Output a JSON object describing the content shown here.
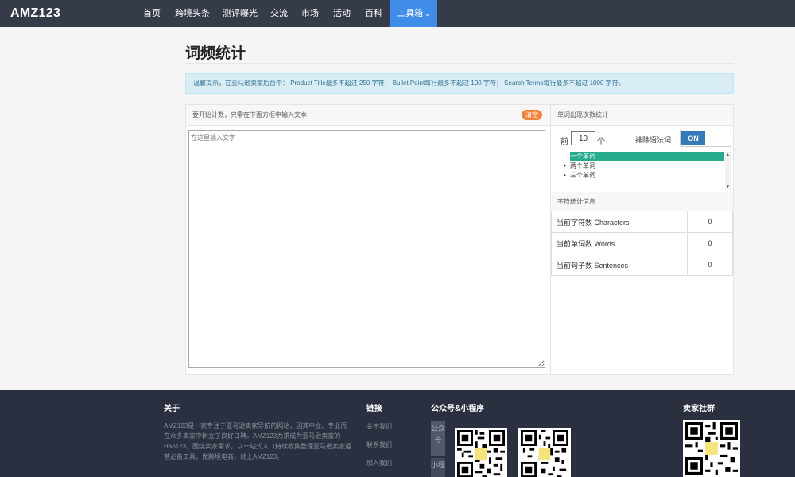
{
  "nav": {
    "logo": "AMZ123",
    "items": [
      {
        "label": "首页"
      },
      {
        "label": "跨境头条"
      },
      {
        "label": "测评曝光"
      },
      {
        "label": "交流"
      },
      {
        "label": "市场"
      },
      {
        "label": "活动"
      },
      {
        "label": "百科"
      },
      {
        "label": "工具箱",
        "active": true
      }
    ],
    "chevron": "chevron-down-icon"
  },
  "page": {
    "title": "词频统计",
    "tip": "温馨提示，在亚马逊卖家后台中：  Product Title最多不超过 250 字符；   Bullet Point每行最多不超过 100 字符；   Search Terms每行最多不超过 1000 字符。"
  },
  "input_panel": {
    "header": "要开始计数，只需在下面方框中输入文本",
    "clear_label": "清空",
    "textarea_placeholder": "在这里输入文字",
    "textarea_value": ""
  },
  "word_count_panel": {
    "header": "单词出现次数统计",
    "prefix": "前",
    "top_n": "10",
    "suffix": "个",
    "exclude_label": "排除语法词",
    "toggle_label": "ON",
    "toggle_state": true,
    "options": [
      {
        "label": "一个单词",
        "selected": true
      },
      {
        "label": "两个单词",
        "selected": false
      },
      {
        "label": "三个单词",
        "selected": false
      }
    ]
  },
  "char_stats": {
    "header": "字符统计信息",
    "rows": [
      {
        "label": "当前字符数 Characters",
        "value": "0"
      },
      {
        "label": "当前单词数 Words",
        "value": "0"
      },
      {
        "label": "当前句子数 Sentences",
        "value": "0"
      }
    ]
  },
  "footer": {
    "about_title": "关于",
    "about_text": "AMZ123是一家专注于亚马逊卖家导航的网站，因其中立、专业而在众多卖家中树立了良好口碑。AMZ123力求成为亚马逊卖家的Hao123，围绕卖家需求，以一站式入口持续收集整理亚马逊卖家运营必备工具，做跨境电商，就上AMZ123。",
    "links_title": "链接",
    "links": [
      "关于我们",
      "联系我们",
      "加入我们"
    ],
    "wechat_title": "公众号&小程序",
    "tabs": [
      "公众号",
      "小程"
    ],
    "community_title": "卖家社群",
    "qr_logo": "AMZ 123"
  },
  "colors": {
    "nav_bg": "#353b48",
    "nav_active": "#3f8ce9",
    "footer_bg": "#2a3040",
    "clear_btn": "#f0823a",
    "toggle_on": "#337ab7",
    "selected_option": "#26ab8e",
    "tip_bg": "#d9edf7"
  }
}
